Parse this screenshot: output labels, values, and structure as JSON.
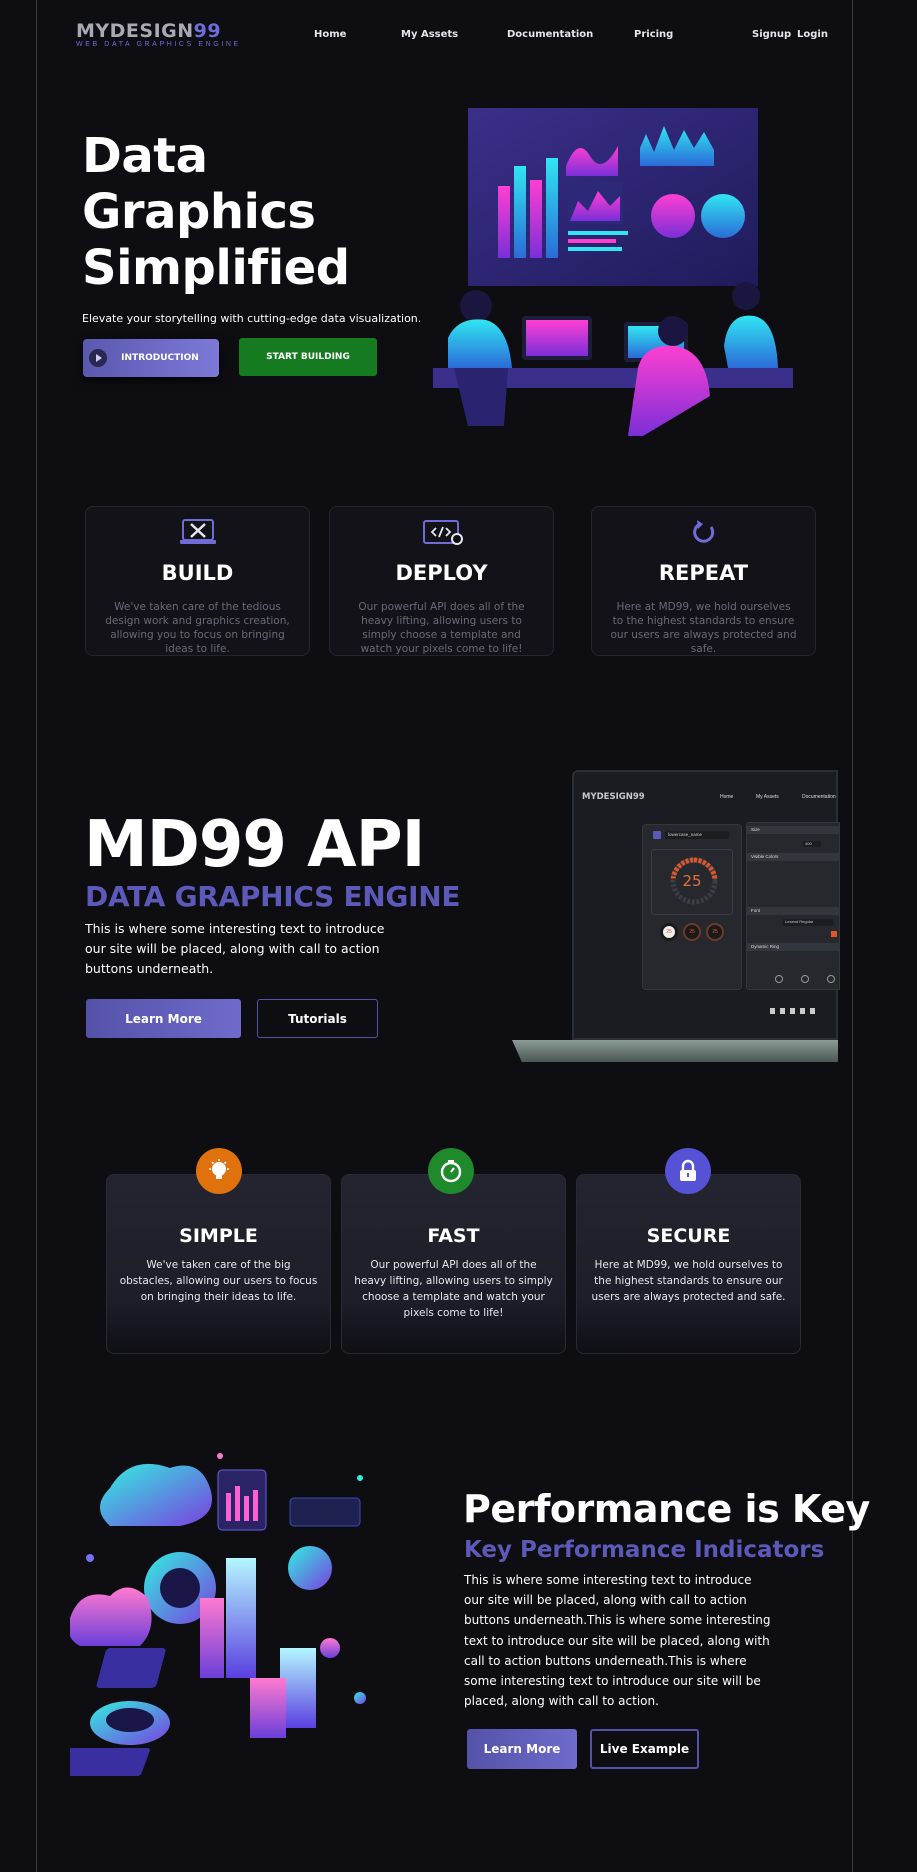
{
  "brand": {
    "logo": "MYDESIGN",
    "logo_suffix": "99",
    "tagline": "WEB DATA GRAPHICS ENGINE"
  },
  "nav": {
    "links": [
      "Home",
      "My Assets",
      "Documentation",
      "Pricing"
    ],
    "signup": "Signup",
    "login": "Login"
  },
  "hero": {
    "title_lines": [
      "Data",
      "Graphics",
      "Simplified"
    ],
    "subtitle": "Elevate your storytelling with cutting-edge data visualization.",
    "intro_button": "INTRODUCTION",
    "start_button": "START BUILDING"
  },
  "features": [
    {
      "title": "BUILD",
      "text": "We've taken care of the tedious design work and  graphics creation, allowing you to focus on bringing ideas to life.",
      "icon": "laptop-tools-icon"
    },
    {
      "title": "DEPLOY",
      "text": "Our powerful API does all of the heavy lifting, allowing users to simply choose a template and watch your pixels come to life!",
      "icon": "code-gear-icon"
    },
    {
      "title": "REPEAT",
      "text": "Here at MD99, we hold ourselves to the highest standards to ensure our users are always protected and safe.",
      "icon": "refresh-icon"
    }
  ],
  "api": {
    "title": "MD99 API",
    "subtitle": "DATA GRAPHICS ENGINE",
    "text": "This is where some interesting text to introduce our site will be placed, along with call to action buttons underneath.",
    "learn_more": "Learn More",
    "tutorials": "Tutorials",
    "mock": {
      "logo": "MYDESIGN99",
      "nav": [
        "Home",
        "My Assets",
        "Documentation"
      ],
      "gauge_value": "25",
      "thumbs": [
        "25",
        "25",
        "25"
      ],
      "panel_headers": [
        "Size",
        "Visible Colors",
        "Font",
        "Dynamic Ring"
      ],
      "font_value": "Lexend Regular",
      "size_value": "400",
      "search_value": "lowercase_name"
    }
  },
  "values": [
    {
      "title": "SIMPLE",
      "text": "We've taken care of the big obstacles, allowing our users to focus on bringing their ideas to life.",
      "color": "#e0720e",
      "icon": "lightbulb-icon"
    },
    {
      "title": "FAST",
      "text": "Our powerful API does all of the heavy lifting, allowing users to simply choose a template and watch your pixels come to life!",
      "color": "#1f8a2c",
      "icon": "stopwatch-icon"
    },
    {
      "title": "SECURE",
      "text": "Here at MD99, we hold ourselves to the highest standards to ensure our users are always protected and safe.",
      "color": "#5552d6",
      "icon": "lock-icon"
    }
  ],
  "performance": {
    "title": "Performance is Key",
    "subtitle": "Key Performance Indicators",
    "text": "This is where some interesting text to introduce our site will be placed, along with call to action buttons underneath.This is where some interesting text to introduce our site will be placed, along with call to action buttons underneath.This is where some interesting text to introduce our site will be placed, along with call to action.",
    "learn_more": "Learn More",
    "live_example": "Live Example"
  },
  "colors": {
    "background": "#0d0d12",
    "accent": "#5d59b8",
    "green": "#157a20"
  }
}
